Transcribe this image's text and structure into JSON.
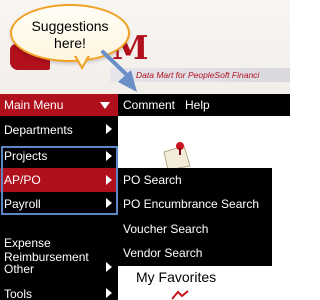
{
  "callout": {
    "text": "Suggestions\nhere!"
  },
  "logo": {
    "letters": "M",
    "tagline": "Data Mart for PeopleSoft Financi"
  },
  "menubar": {
    "main_menu_label": "Main Menu",
    "items": [
      {
        "label": "Comment"
      },
      {
        "label": "Help"
      }
    ]
  },
  "sidebar": {
    "items": [
      {
        "label": "Departments"
      },
      {
        "label": "Projects"
      },
      {
        "label": "AP/PO"
      },
      {
        "label": "Payroll"
      },
      {
        "label": "Expense\nReimbursement"
      },
      {
        "label": "Other"
      },
      {
        "label": "Tools"
      }
    ]
  },
  "submenu": {
    "items": [
      {
        "label": "PO Search"
      },
      {
        "label": "PO Encumbrance Search"
      },
      {
        "label": "Voucher Search"
      },
      {
        "label": "Vendor Search"
      }
    ]
  },
  "content": {
    "favorites_title": "My Favorites"
  },
  "colors": {
    "menu_red": "#b0101c",
    "menu_black": "#000000",
    "callout_border": "#f0a022",
    "highlight_blue": "#5b87c6",
    "arrow_blue": "#6c8fc8"
  }
}
